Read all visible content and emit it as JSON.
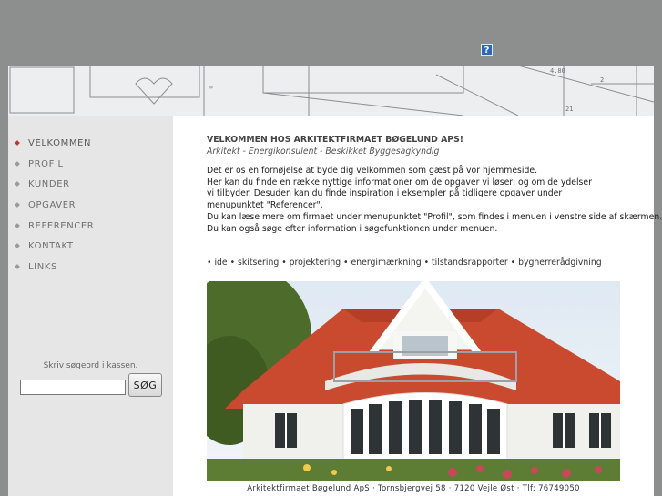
{
  "help": {
    "label": "?"
  },
  "nav": {
    "items": [
      {
        "label": "VELKOMMEN",
        "active": true
      },
      {
        "label": "PROFIL",
        "active": false
      },
      {
        "label": "KUNDER",
        "active": false
      },
      {
        "label": "OPGAVER",
        "active": false
      },
      {
        "label": "REFERENCER",
        "active": false
      },
      {
        "label": "KONTAKT",
        "active": false
      },
      {
        "label": "LINKS",
        "active": false
      }
    ]
  },
  "search": {
    "hint": "Skriv søgeord i kassen.",
    "value": "",
    "button_label": "SØG"
  },
  "main": {
    "title": "VELKOMMEN HOS ARKITEKTFIRMAET BØGELUND APS!",
    "subtitle": "Arkitekt - Energikonsulent - Beskikket Byggesagkyndig",
    "paragraph": [
      "Det er os en fornøjelse at byde dig velkommen som gæst på vor hjemmeside.",
      "Her kan du finde en række nyttige informationer om de opgaver vi løser, og om de ydelser",
      "vi tilbyder. Desuden kan du finde inspiration i eksempler på tidligere opgaver under",
      "menupunktet \"Referencer\".",
      "Du kan læse mere om firmaet under menupunktet \"Profil\", som findes i menuen i venstre side af skærmen.",
      "Du kan også søge efter information i søgefunktionen under menuen."
    ],
    "services": "• ide • skitsering • projektering • energimærkning • tilstandsrapporter • bygherrerådgivning"
  },
  "footer": {
    "text": "Arkitektfirmaet Bøgelund ApS · Tornsbjergvej 58 · 7120 Vejle Øst · Tlf: 76749050"
  },
  "colors": {
    "page_bg": "#8c8f8d",
    "sidebar_bg": "#e6e6e6",
    "active_bullet": "#b33a3a",
    "roof": "#c94a2e"
  }
}
